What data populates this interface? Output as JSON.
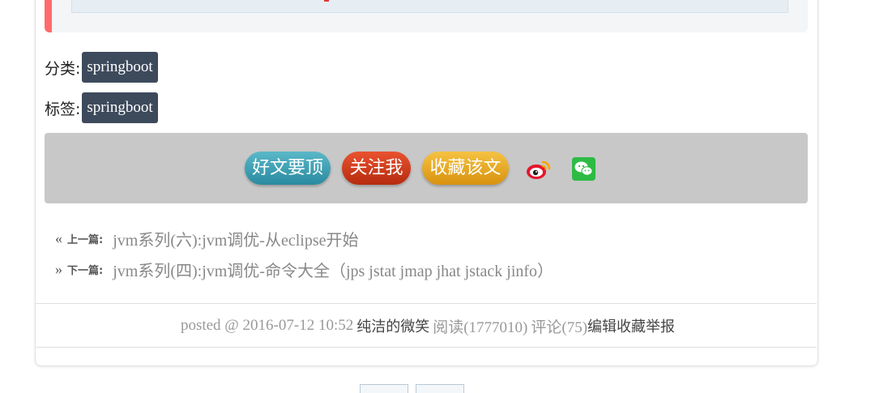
{
  "post": {
    "category_label": "分类:",
    "category_tag": "springboot",
    "tags_label": "标签:",
    "tag": "springboot"
  },
  "share": {
    "digg_label": "好文要顶",
    "follow_label": "关注我",
    "favorite_label": "收藏该文",
    "icons": [
      "weibo-icon",
      "wechat-icon"
    ],
    "colors": {
      "bar_bg": "#c8c8c8",
      "digg": "#3a9db2",
      "follow": "#d23c1a",
      "favorite": "#e8a920"
    }
  },
  "nav": {
    "prev_arrow": "«",
    "prev_label": "上一篇:",
    "prev_title": "jvm系列(六):jvm调优-从eclipse开始",
    "next_arrow": "»",
    "next_label": "下一篇:",
    "next_title": "jvm系列(四):jvm调优-命令大全（jps jstat jmap jhat jstack jinfo）"
  },
  "footer": {
    "posted": "posted @ 2016-07-12 10:52",
    "author": "纯洁的微笑",
    "reads": "阅读(1777010)",
    "comments": "评论(75)",
    "edit": "编辑",
    "favorite": "收藏",
    "report": "举报"
  },
  "colors": {
    "tag_bg": "#3d4a5c",
    "quote_border": "#ff6b6b"
  }
}
